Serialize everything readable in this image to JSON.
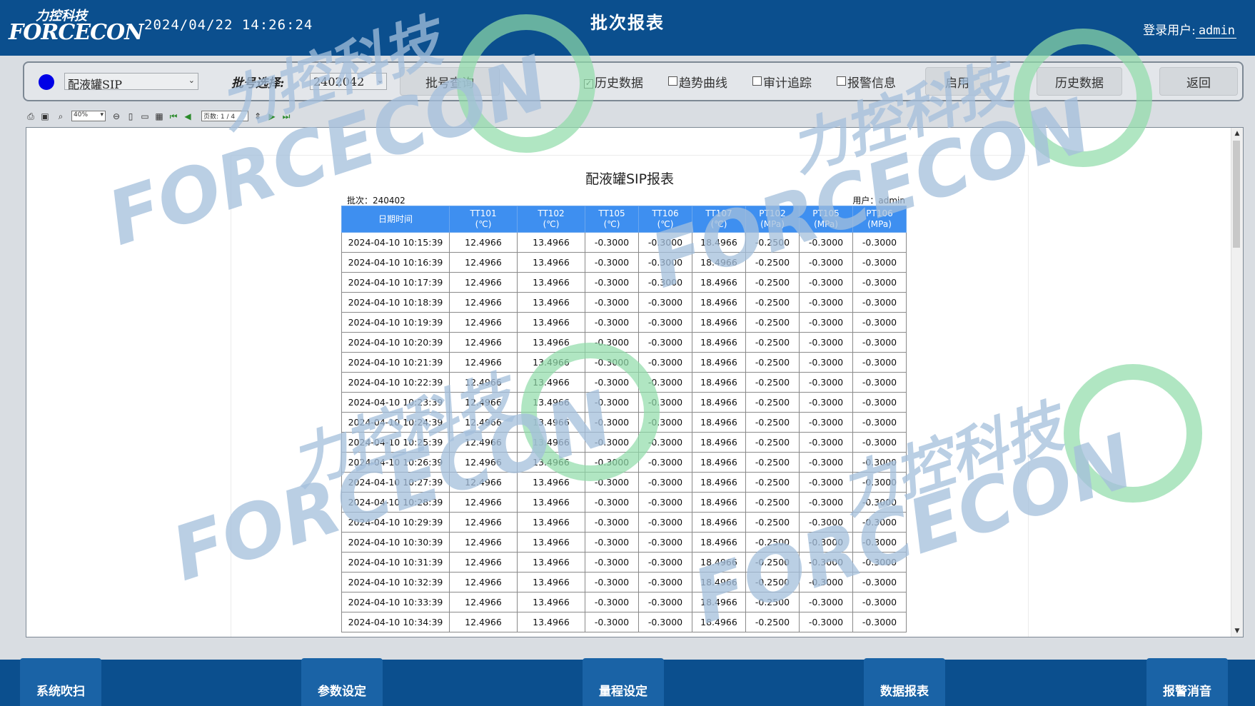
{
  "header": {
    "logo_cn": "力控科技",
    "logo_en": "FORCECON",
    "datetime": "2024/04/22 14:26:24",
    "title": "批次报表",
    "login_label": "登录用户:",
    "login_user": "admin"
  },
  "toolbar": {
    "status_color": "#0000e6",
    "tank_select": "配液罐SIP",
    "batch_label": "批号选择:",
    "batch_select": "2402042",
    "query_button": "批号查询",
    "checkboxes": [
      {
        "label": "历史数据",
        "checked": true
      },
      {
        "label": "趋势曲线",
        "checked": false
      },
      {
        "label": "审计追踪",
        "checked": false
      },
      {
        "label": "报警信息",
        "checked": false
      }
    ],
    "enable_button": "启用",
    "history_button": "历史数据",
    "back_button": "返回"
  },
  "viewer_toolbar": {
    "zoom": "40%",
    "page_label": "页数:",
    "page_value": "1 / 4",
    "icons": [
      "print-icon",
      "print-preview-icon",
      "find-icon",
      "zoom-out-icon",
      "page-single-icon",
      "page-width-icon",
      "page-multi-icon",
      "first-page-icon",
      "prev-page-icon",
      "next-page-icon",
      "last-page-icon"
    ]
  },
  "report": {
    "title": "配液罐SIP报表",
    "batch": "批次：240402",
    "user": "用户：admin",
    "columns": [
      {
        "name": "日期时间",
        "unit": ""
      },
      {
        "name": "TT101",
        "unit": "(℃)"
      },
      {
        "name": "TT102",
        "unit": "(℃)"
      },
      {
        "name": "TT105",
        "unit": "(℃)"
      },
      {
        "name": "TT106",
        "unit": "(℃)"
      },
      {
        "name": "TT107",
        "unit": "(℃)"
      },
      {
        "name": "PT102",
        "unit": "(MPa)"
      },
      {
        "name": "PT105",
        "unit": "(MPa)"
      },
      {
        "name": "PT106",
        "unit": "(MPa)"
      }
    ],
    "rows": [
      [
        "2024-04-10 10:15:39",
        "12.4966",
        "13.4966",
        "-0.3000",
        "-0.3000",
        "18.4966",
        "-0.2500",
        "-0.3000",
        "-0.3000"
      ],
      [
        "2024-04-10 10:16:39",
        "12.4966",
        "13.4966",
        "-0.3000",
        "-0.3000",
        "18.4966",
        "-0.2500",
        "-0.3000",
        "-0.3000"
      ],
      [
        "2024-04-10 10:17:39",
        "12.4966",
        "13.4966",
        "-0.3000",
        "-0.3000",
        "18.4966",
        "-0.2500",
        "-0.3000",
        "-0.3000"
      ],
      [
        "2024-04-10 10:18:39",
        "12.4966",
        "13.4966",
        "-0.3000",
        "-0.3000",
        "18.4966",
        "-0.2500",
        "-0.3000",
        "-0.3000"
      ],
      [
        "2024-04-10 10:19:39",
        "12.4966",
        "13.4966",
        "-0.3000",
        "-0.3000",
        "18.4966",
        "-0.2500",
        "-0.3000",
        "-0.3000"
      ],
      [
        "2024-04-10 10:20:39",
        "12.4966",
        "13.4966",
        "-0.3000",
        "-0.3000",
        "18.4966",
        "-0.2500",
        "-0.3000",
        "-0.3000"
      ],
      [
        "2024-04-10 10:21:39",
        "12.4966",
        "13.4966",
        "-0.3000",
        "-0.3000",
        "18.4966",
        "-0.2500",
        "-0.3000",
        "-0.3000"
      ],
      [
        "2024-04-10 10:22:39",
        "12.4966",
        "13.4966",
        "-0.3000",
        "-0.3000",
        "18.4966",
        "-0.2500",
        "-0.3000",
        "-0.3000"
      ],
      [
        "2024-04-10 10:23:39",
        "12.4966",
        "13.4966",
        "-0.3000",
        "-0.3000",
        "18.4966",
        "-0.2500",
        "-0.3000",
        "-0.3000"
      ],
      [
        "2024-04-10 10:24:39",
        "12.4966",
        "13.4966",
        "-0.3000",
        "-0.3000",
        "18.4966",
        "-0.2500",
        "-0.3000",
        "-0.3000"
      ],
      [
        "2024-04-10 10:25:39",
        "12.4966",
        "13.4966",
        "-0.3000",
        "-0.3000",
        "18.4966",
        "-0.2500",
        "-0.3000",
        "-0.3000"
      ],
      [
        "2024-04-10 10:26:39",
        "12.4966",
        "13.4966",
        "-0.3000",
        "-0.3000",
        "18.4966",
        "-0.2500",
        "-0.3000",
        "-0.3000"
      ],
      [
        "2024-04-10 10:27:39",
        "12.4966",
        "13.4966",
        "-0.3000",
        "-0.3000",
        "18.4966",
        "-0.2500",
        "-0.3000",
        "-0.3000"
      ],
      [
        "2024-04-10 10:28:39",
        "12.4966",
        "13.4966",
        "-0.3000",
        "-0.3000",
        "18.4966",
        "-0.2500",
        "-0.3000",
        "-0.3000"
      ],
      [
        "2024-04-10 10:29:39",
        "12.4966",
        "13.4966",
        "-0.3000",
        "-0.3000",
        "18.4966",
        "-0.2500",
        "-0.3000",
        "-0.3000"
      ],
      [
        "2024-04-10 10:30:39",
        "12.4966",
        "13.4966",
        "-0.3000",
        "-0.3000",
        "18.4966",
        "-0.2500",
        "-0.3000",
        "-0.3000"
      ],
      [
        "2024-04-10 10:31:39",
        "12.4966",
        "13.4966",
        "-0.3000",
        "-0.3000",
        "18.4966",
        "-0.2500",
        "-0.3000",
        "-0.3000"
      ],
      [
        "2024-04-10 10:32:39",
        "12.4966",
        "13.4966",
        "-0.3000",
        "-0.3000",
        "18.4966",
        "-0.2500",
        "-0.3000",
        "-0.3000"
      ],
      [
        "2024-04-10 10:33:39",
        "12.4966",
        "13.4966",
        "-0.3000",
        "-0.3000",
        "18.4966",
        "-0.2500",
        "-0.3000",
        "-0.3000"
      ],
      [
        "2024-04-10 10:34:39",
        "12.4966",
        "13.4966",
        "-0.3000",
        "-0.3000",
        "18.4966",
        "-0.2500",
        "-0.3000",
        "-0.3000"
      ]
    ]
  },
  "watermark": {
    "cn": "力控科技",
    "en": "FORCECON"
  },
  "footer": {
    "buttons": [
      "系统吹扫",
      "参数设定",
      "量程设定",
      "数据报表",
      "报警消音"
    ]
  }
}
